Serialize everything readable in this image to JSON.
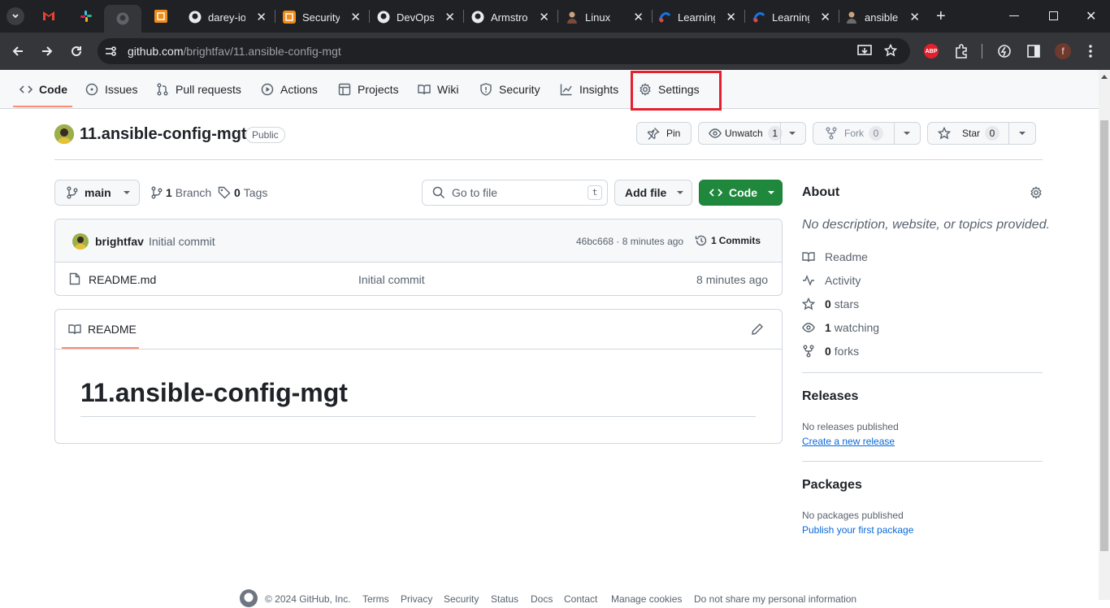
{
  "browser": {
    "tabs": [
      {
        "title": "",
        "icon": "gmail-icon"
      },
      {
        "title": "",
        "icon": "slack-icon"
      },
      {
        "title": "",
        "icon": "github-icon"
      },
      {
        "title": "",
        "icon": "orange-app-icon"
      },
      {
        "title": "darey-io",
        "icon": "github-icon"
      },
      {
        "title": "Security",
        "icon": "orange-app-icon"
      },
      {
        "title": "DevOps",
        "icon": "github-icon"
      },
      {
        "title": "Armstro",
        "icon": "github-icon"
      },
      {
        "title": "Linux",
        "icon": "avatar-icon"
      },
      {
        "title": "Learning",
        "icon": "blue-app-icon"
      },
      {
        "title": "Learning",
        "icon": "blue-app-icon"
      },
      {
        "title": "ansible",
        "icon": "avatar-icon"
      }
    ],
    "url_host": "github.com",
    "url_path": "/brightfav/11.ansible-config-mgt",
    "profile_initial": "f",
    "adblock_label": "ABP"
  },
  "repo_nav": {
    "items": [
      "Code",
      "Issues",
      "Pull requests",
      "Actions",
      "Projects",
      "Wiki",
      "Security",
      "Insights",
      "Settings"
    ]
  },
  "repo": {
    "name": "11.ansible-config-mgt",
    "visibility": "Public",
    "pin_label": "Pin",
    "unwatch_label": "Unwatch",
    "unwatch_count": "1",
    "fork_label": "Fork",
    "fork_count": "0",
    "star_label": "Star",
    "star_count": "0"
  },
  "filebar": {
    "branch": "main",
    "branch_count": "1",
    "branch_label": "Branch",
    "tags_count": "0",
    "tags_label": "Tags",
    "search_placeholder": "Go to file",
    "search_shortcut": "t",
    "add_file": "Add file",
    "code_button": "Code"
  },
  "commit": {
    "author": "brightfav",
    "message": "Initial commit",
    "hash_time": "46bc668 · 8 minutes ago",
    "commits_count": "1",
    "commits_label": "Commits"
  },
  "files": [
    {
      "name": "README.md",
      "message": "Initial commit",
      "time": "8 minutes ago"
    }
  ],
  "readme": {
    "tab_label": "README",
    "heading": "11.ansible-config-mgt"
  },
  "about": {
    "title": "About",
    "description": "No description, website, or topics provided.",
    "readme": "Readme",
    "activity": "Activity",
    "stars_count": "0",
    "stars_label": "stars",
    "watching_count": "1",
    "watching_label": "watching",
    "forks_count": "0",
    "forks_label": "forks"
  },
  "releases": {
    "title": "Releases",
    "empty": "No releases published",
    "create_link": "Create a new release"
  },
  "packages": {
    "title": "Packages",
    "empty": "No packages published",
    "publish_link": "Publish your first package"
  },
  "footer": {
    "copyright": "© 2024 GitHub, Inc.",
    "links": [
      "Terms",
      "Privacy",
      "Security",
      "Status",
      "Docs",
      "Contact",
      "Manage cookies",
      "Do not share my personal information"
    ]
  },
  "colors": {
    "accent_green": "#1f883d",
    "highlight_red": "#e5202e",
    "tab_underline": "#fd8c73",
    "link_blue": "#0969da"
  }
}
